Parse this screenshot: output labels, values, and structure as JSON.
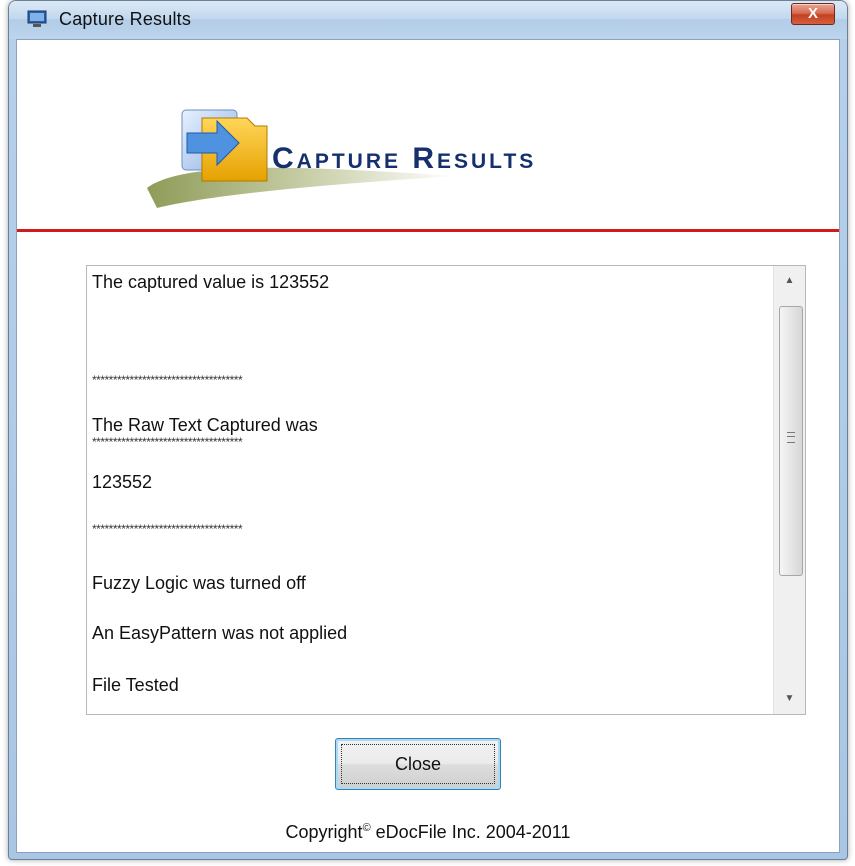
{
  "window": {
    "title": "Capture Results",
    "close_glyph": "X",
    "icon": "monitor-icon"
  },
  "banner": {
    "title": "Capture Results",
    "logo": "folder-arrow-logo"
  },
  "results": {
    "lines": [
      "The captured value is 123552",
      "************************************",
      "The Raw Text Captured was",
      "************************************",
      "123552",
      "************************************",
      "Fuzzy Logic was turned off",
      "An EasyPattern was not applied",
      "File Tested"
    ]
  },
  "buttons": {
    "close_label": "Close"
  },
  "footer": {
    "copyright_prefix": "Copyright",
    "copyright_mark": "©",
    "copyright_suffix": " eDocFile Inc. 2004-2011"
  },
  "colors": {
    "accent_line": "#d01c1c",
    "banner_title": "#16306e"
  }
}
